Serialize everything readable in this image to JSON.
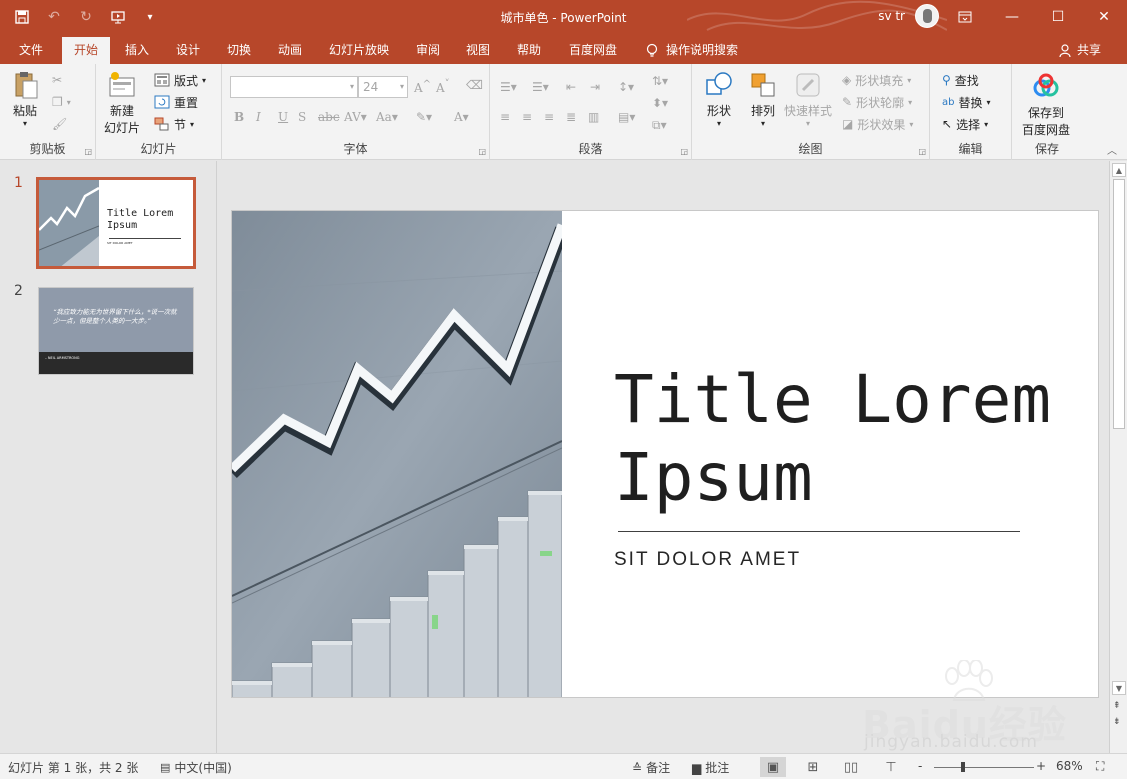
{
  "titlebar": {
    "doc_title": "城市单色  -  PowerPoint",
    "user_name": "sv tr"
  },
  "tabs": [
    {
      "label": "文件"
    },
    {
      "label": "开始"
    },
    {
      "label": "插入"
    },
    {
      "label": "设计"
    },
    {
      "label": "切换"
    },
    {
      "label": "动画"
    },
    {
      "label": "幻灯片放映"
    },
    {
      "label": "审阅"
    },
    {
      "label": "视图"
    },
    {
      "label": "帮助"
    },
    {
      "label": "百度网盘"
    }
  ],
  "tell_me": "操作说明搜索",
  "share": "共享",
  "ribbon": {
    "clipboard": {
      "label": "剪贴板",
      "paste": "粘贴"
    },
    "slides": {
      "label": "幻灯片",
      "new_slide_1": "新建",
      "new_slide_2": "幻灯片",
      "layout": "版式",
      "reset": "重置",
      "section": "节"
    },
    "font": {
      "label": "字体",
      "size_value": "24"
    },
    "paragraph": {
      "label": "段落"
    },
    "drawing": {
      "label": "绘图",
      "shapes": "形状",
      "arrange": "排列",
      "quick_styles": "快速样式",
      "shape_fill": "形状填充",
      "shape_outline": "形状轮廓",
      "shape_effects": "形状效果"
    },
    "editing": {
      "label": "编辑",
      "find": "查找",
      "replace": "替换",
      "select": "选择"
    },
    "save": {
      "label": "保存",
      "save_to_1": "保存到",
      "save_to_2": "百度网盘"
    }
  },
  "thumbnails": [
    {
      "number": "1",
      "title": "Title Lorem Ipsum",
      "subtitle": "SIT DOLOR AMET"
    },
    {
      "number": "2",
      "quote": "“我应致力能无为世界留下什么，*说一次就少一点，但是整个人类的一大步。”",
      "author": "– NEIL ARMSTRONG"
    }
  ],
  "slide": {
    "title": "Title Lorem Ipsum",
    "subtitle": "SIT DOLOR AMET"
  },
  "status": {
    "slide_info": "幻灯片 第 1 张，共 2 张",
    "language": "中文(中国)",
    "notes": "备注",
    "comments": "批注",
    "zoom_minus": "-",
    "zoom_plus": "+",
    "zoom": "68%"
  },
  "watermark": {
    "text": "Baidu经验",
    "url": "jingyan.baidu.com"
  }
}
